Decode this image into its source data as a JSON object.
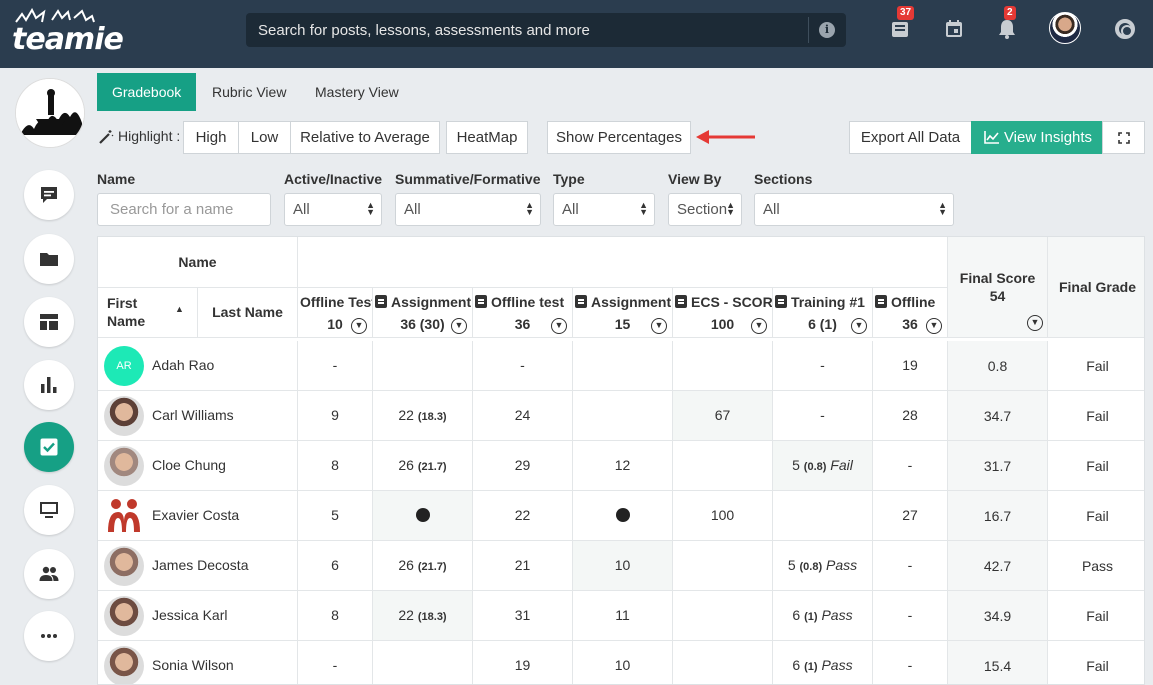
{
  "app": {
    "logo_text": "teamie"
  },
  "search": {
    "placeholder": "Search for posts, lessons, assessments and more"
  },
  "topbar": {
    "inbox_badge": "37",
    "notifications_badge": "2"
  },
  "tabs": [
    {
      "label": "Gradebook",
      "active": true
    },
    {
      "label": "Rubric View",
      "active": false
    },
    {
      "label": "Mastery View",
      "active": false
    }
  ],
  "highlight": {
    "label": "Highlight :",
    "options": [
      "High",
      "Low",
      "Relative to Average"
    ],
    "heatmap": "HeatMap",
    "show_percentages": "Show Percentages"
  },
  "actions": {
    "export": "Export All Data",
    "insights": "View Insights"
  },
  "filters": {
    "name": {
      "label": "Name",
      "placeholder": "Search for a name"
    },
    "active": {
      "label": "Active/Inactive",
      "value": "All"
    },
    "summative": {
      "label": "Summative/Formative",
      "value": "All"
    },
    "type": {
      "label": "Type",
      "value": "All"
    },
    "view_by": {
      "label": "View By",
      "value": "Section"
    },
    "sections": {
      "label": "Sections",
      "value": "All"
    }
  },
  "table": {
    "name_header": "Name",
    "first_name": "First Name",
    "last_name": "Last Name",
    "final_score": {
      "label": "Final Score",
      "value": "54"
    },
    "final_grade": "Final Grade",
    "columns": [
      {
        "title": "Offline Test",
        "max": "10"
      },
      {
        "title": "Assignment",
        "max": "36 (30)"
      },
      {
        "title": "Offline test",
        "max": "36"
      },
      {
        "title": "Assignment",
        "max": "15"
      },
      {
        "title": "ECS - SCORM",
        "max": "100"
      },
      {
        "title": "Training #1",
        "max": "6 (1)"
      },
      {
        "title": "Offline",
        "max": "36"
      }
    ],
    "rows": [
      {
        "name": "Adah Rao",
        "initials": "AR",
        "cells": [
          "-",
          "",
          "-",
          "",
          "",
          "-",
          "19"
        ],
        "score": "0.8",
        "grade": "Fail"
      },
      {
        "name": "Carl Williams",
        "cells": [
          "9",
          "22|(18.3)",
          "24",
          "",
          "67",
          "-",
          "28"
        ],
        "score": "34.7",
        "grade": "Fail"
      },
      {
        "name": "Cloe Chung",
        "cells": [
          "8",
          "26|(21.7)",
          "29",
          "12",
          "",
          "5|(0.8)|Fail",
          "-"
        ],
        "score": "31.7",
        "grade": "Fail"
      },
      {
        "name": "Exavier Costa",
        "cells": [
          "5",
          "dot",
          "22",
          "dot",
          "100",
          "",
          "27"
        ],
        "score": "16.7",
        "grade": "Fail"
      },
      {
        "name": "James Decosta",
        "cells": [
          "6",
          "26|(21.7)",
          "21",
          "10",
          "",
          "5|(0.8)|Pass",
          "-"
        ],
        "score": "42.7",
        "grade": "Pass"
      },
      {
        "name": "Jessica Karl",
        "cells": [
          "8",
          "22|(18.3)",
          "31",
          "11",
          "",
          "6|(1)|Pass",
          "-"
        ],
        "score": "34.9",
        "grade": "Fail"
      },
      {
        "name": "Sonia Wilson",
        "cells": [
          "-",
          "",
          "19",
          "10",
          "",
          "6|(1)|Pass",
          "-"
        ],
        "score": "15.4",
        "grade": "Fail"
      }
    ]
  },
  "colors": {
    "accent": "#16a085",
    "topbar": "#2b3d4f",
    "badge": "#e53935",
    "arrow": "#e53935"
  }
}
